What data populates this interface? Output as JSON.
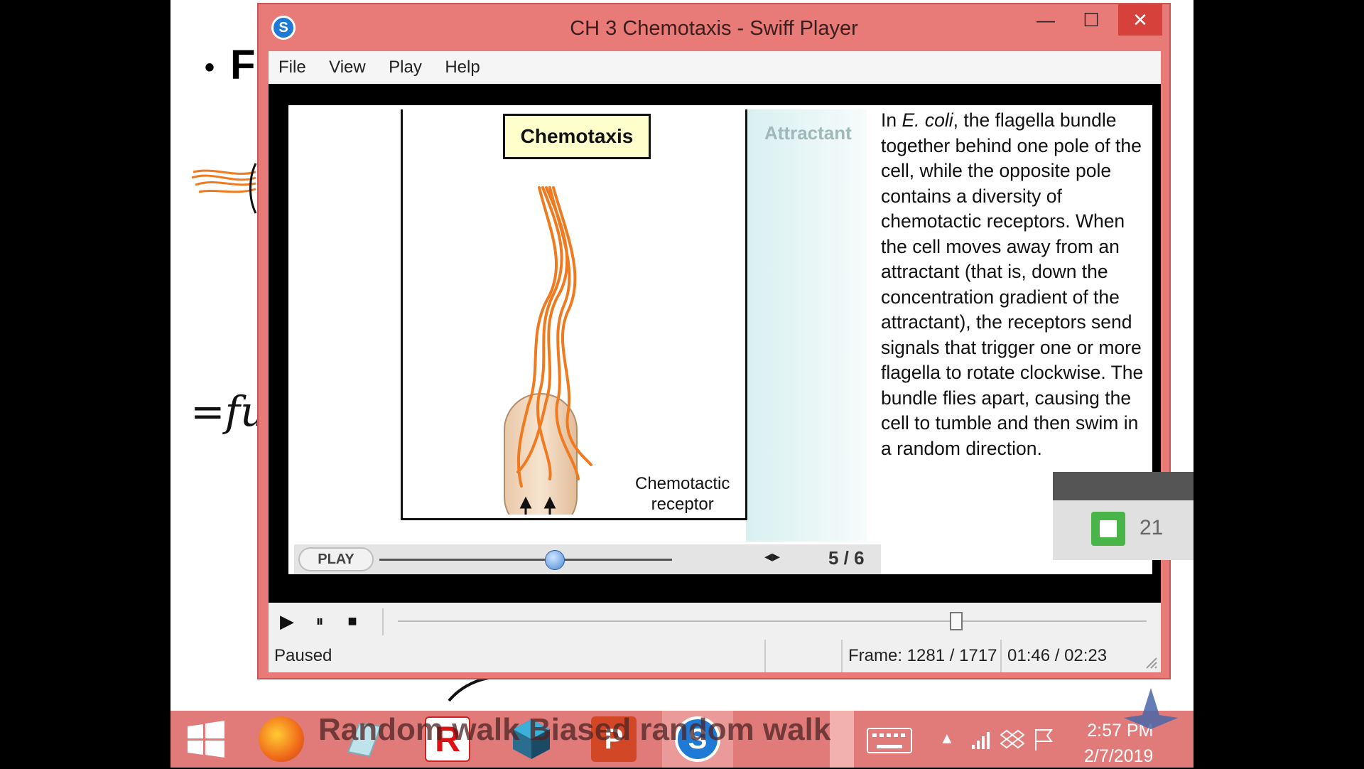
{
  "desktop": {
    "slide_bullet_text": "F",
    "ink_note": "=fu"
  },
  "window": {
    "title": "CH 3 Chemotaxis - Swiff Player",
    "icon": "swiff-logo-icon",
    "controls": {
      "minimize": "—",
      "maximize": "☐",
      "close": "✕"
    },
    "menu": [
      "File",
      "View",
      "Play",
      "Help"
    ]
  },
  "animation": {
    "heading": "Chemotaxis",
    "gradient_label": "Attractant",
    "receptor_label_line1": "Chemotactic",
    "receptor_label_line2": "receptor",
    "play_button": "PLAY",
    "nav_arrows": "◂▸",
    "page": "5 / 6",
    "slider_fraction": 0.6,
    "description": "In E. coli, the flagella bundle together behind one pole of the cell, while the opposite pole contains a diversity of chemotactic receptors. When the cell moves away from an attractant (that is, down the concentration gradient of the attractant), the receptors send signals that trigger one or more flagella to rotate clockwise. The bundle flies apart, causing the cell to tumble and then swim in a random direction.",
    "description_italic": "E. coli"
  },
  "transport": {
    "play": "▶",
    "pause": "⏸",
    "stop": "■",
    "seek_fraction": 0.746
  },
  "status": {
    "state": "Paused",
    "frame": "Frame: 1281 / 1717",
    "time": "01:46 / 02:23"
  },
  "side_widget": {
    "number": "21"
  },
  "taskbar": {
    "overlay_text": "Random walk  Biased random walk",
    "apps": [
      "windows-start-icon",
      "firefox-icon",
      "notepad-icon",
      "r-app-icon",
      "cube-app-icon",
      "powerpoint-icon",
      "swiff-player-icon",
      "keyboard-icon"
    ],
    "clock_time": "2:57 PM",
    "clock_date": "2/7/2019"
  },
  "colors": {
    "window_frame": "#e87a78",
    "close_button": "#d7413b",
    "heading_box": "#ffffcc",
    "flagella": "#f07a20"
  }
}
